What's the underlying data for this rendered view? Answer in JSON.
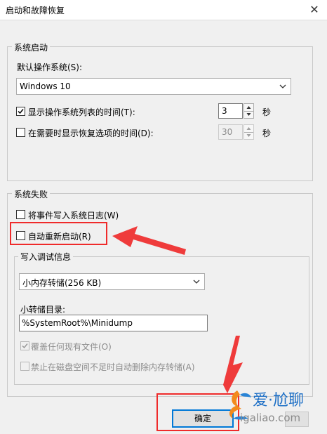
{
  "window": {
    "title": "启动和故障恢复"
  },
  "system_startup": {
    "group_label": "系统启动",
    "default_os_label": "默认操作系统(S):",
    "default_os_value": "Windows 10",
    "show_list": {
      "label": "显示操作系统列表的时间(T):",
      "checked": true,
      "value": "3",
      "unit": "秒"
    },
    "show_recovery": {
      "label": "在需要时显示恢复选项的时间(D):",
      "checked": false,
      "value": "30",
      "unit": "秒"
    }
  },
  "system_failure": {
    "group_label": "系统失败",
    "write_event_log": {
      "label": "将事件写入系统日志(W)",
      "checked": false
    },
    "auto_restart": {
      "label": "自动重新启动(R)",
      "checked": false
    },
    "debug_info": {
      "group_label": "写入调试信息",
      "dump_type": "小内存转储(256 KB)",
      "dir_label": "小转储目录:",
      "dir_value": "%SystemRoot%\\Minidump",
      "overwrite": {
        "label": "覆盖任何现有文件(O)",
        "checked": true
      },
      "disable_auto_delete": {
        "label": "禁止在磁盘空间不足时自动删除内存转储(A)",
        "checked": false
      }
    }
  },
  "buttons": {
    "ok": "确定"
  },
  "watermark": {
    "cn": "爱·尬聊",
    "url": "igaliao.com"
  },
  "colors": {
    "highlight_red": "#ef2b2b",
    "focus_blue": "#0078d7"
  }
}
